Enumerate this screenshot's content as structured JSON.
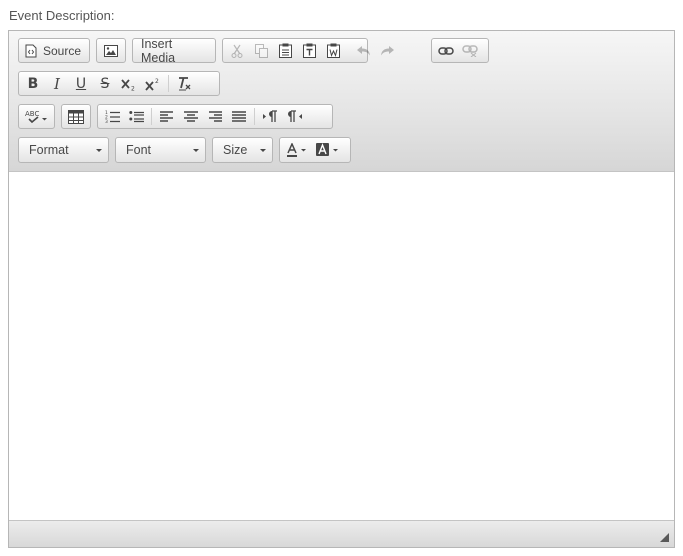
{
  "field_label": "Event Description:",
  "toolbar": {
    "source_label": "Source",
    "insert_media_label": "Insert Media",
    "format_label": "Format",
    "font_label": "Font",
    "size_label": "Size",
    "bold_glyph": "B",
    "italic_glyph": "I",
    "underline_glyph": "U",
    "strike_glyph": "S"
  }
}
